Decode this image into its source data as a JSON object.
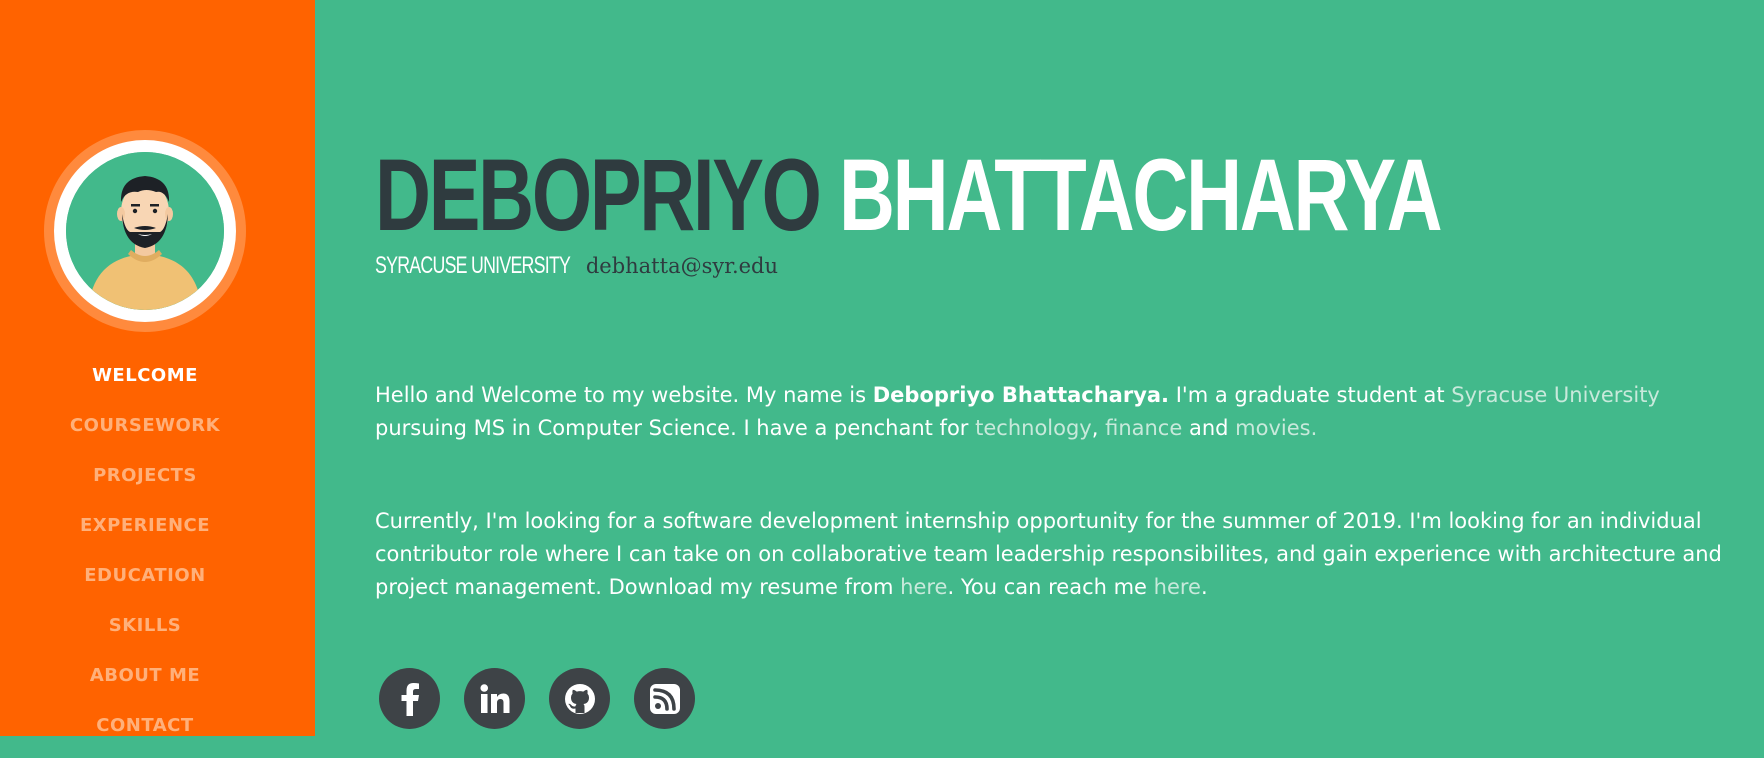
{
  "sidebar": {
    "nav": [
      {
        "label": "WELCOME",
        "active": true
      },
      {
        "label": "COURSEWORK",
        "active": false
      },
      {
        "label": "PROJECTS",
        "active": false
      },
      {
        "label": "EXPERIENCE",
        "active": false
      },
      {
        "label": "EDUCATION",
        "active": false
      },
      {
        "label": "SKILLS",
        "active": false
      },
      {
        "label": "ABOUT ME",
        "active": false
      },
      {
        "label": "CONTACT",
        "active": false
      }
    ]
  },
  "header": {
    "first_name": "DEBOPRIYO",
    "last_name": "BHATTACHARYA",
    "university": "SYRACUSE UNIVERSITY",
    "email": "debhatta@syr.edu"
  },
  "intro": {
    "p1_a": "Hello and Welcome to my website. My name is ",
    "p1_name": "Debopriyo Bhattacharya.",
    "p1_b": " I'm a graduate student at ",
    "p1_uni": "Syracuse University",
    "p1_c": " pursuing MS in Computer Science. I have a penchant for ",
    "p1_tech": "technology",
    "p1_comma": ", ",
    "p1_fin": "finance",
    "p1_and": " and ",
    "p1_movies": "movies.",
    "p2_a": "Currently, I'm looking for a software development internship opportunity for the summer of 2019. I'm looking for an individual contributor role where I can take on on collaborative team leadership responsibilites, and gain experience with architecture and project management. Download my resume from ",
    "p2_link1": "here",
    "p2_b": ". You can reach me ",
    "p2_link2": "here",
    "p2_c": "."
  },
  "socials": [
    {
      "icon": "facebook-icon"
    },
    {
      "icon": "linkedin-icon"
    },
    {
      "icon": "github-icon"
    },
    {
      "icon": "rss-icon"
    }
  ],
  "colors": {
    "sidebar": "#ff6300",
    "main": "#42b98b",
    "dark": "#2f3b3f",
    "link": "#c8e9db",
    "social_bg": "#3e4347"
  }
}
